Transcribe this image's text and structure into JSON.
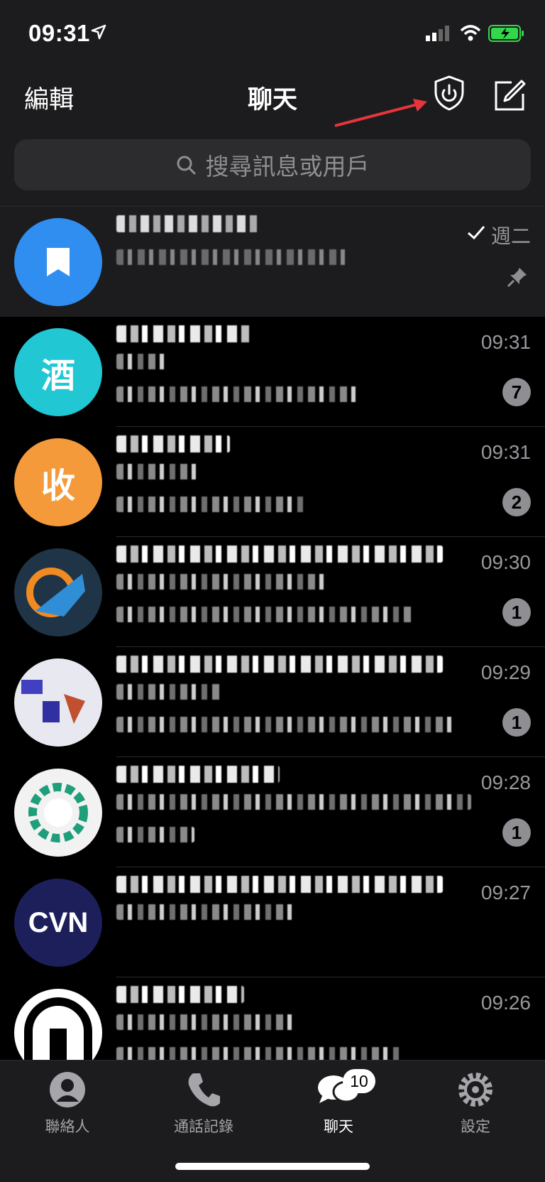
{
  "status_bar": {
    "time": "09:31"
  },
  "nav": {
    "edit_label": "編輯",
    "title": "聊天",
    "search_placeholder": "搜尋訊息或用戶"
  },
  "chats": [
    {
      "time": "週二",
      "badge": "",
      "pinned": true,
      "read": true,
      "avatar_color": "#2f8ef0",
      "avatar_letter": ""
    },
    {
      "time": "09:31",
      "badge": "7",
      "avatar_color": "#22c7d4",
      "avatar_letter": "酒"
    },
    {
      "time": "09:31",
      "badge": "2",
      "avatar_color": "#f59a3a",
      "avatar_letter": "收"
    },
    {
      "time": "09:30",
      "badge": "1",
      "avatar_color": "#1f3446",
      "avatar_letter": ""
    },
    {
      "time": "09:29",
      "badge": "1",
      "avatar_color": "#e8e8f0",
      "avatar_letter": ""
    },
    {
      "time": "09:28",
      "badge": "1",
      "avatar_color": "#f2f2f2",
      "avatar_letter": ""
    },
    {
      "time": "09:27",
      "badge": "",
      "avatar_color": "#1d1f5a",
      "avatar_letter": "CVN"
    },
    {
      "time": "09:26",
      "badge": "",
      "avatar_color": "#ffffff",
      "avatar_letter": ""
    }
  ],
  "tabs": [
    {
      "label": "聯絡人",
      "icon": "contacts-icon"
    },
    {
      "label": "通話記錄",
      "icon": "phone-icon"
    },
    {
      "label": "聊天",
      "icon": "chat-bubbles-icon",
      "badge": "10",
      "active": true
    },
    {
      "label": "設定",
      "icon": "gear-icon"
    }
  ],
  "colors": {
    "accent_arrow": "#e8353b",
    "bar_bg": "#1c1c1e",
    "battery": "#32d74b"
  }
}
